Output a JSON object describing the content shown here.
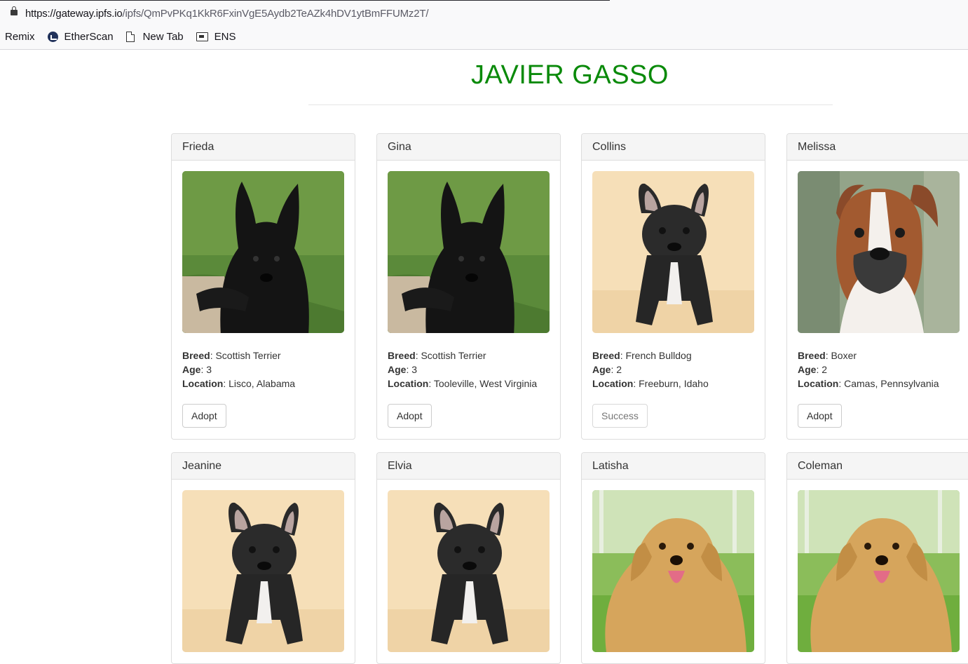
{
  "browser": {
    "url_host": "https://gateway.ipfs.io",
    "url_path": "/ipfs/QmPvPKq1KkR6FxinVgE5Aydb2TeAZk4hDV1ytBmFFUMz2T/",
    "bookmarks": [
      "Remix",
      "EtherScan",
      "New Tab",
      "ENS"
    ]
  },
  "page": {
    "title": "JAVIER GASSO",
    "labels": {
      "breed": "Breed",
      "age": "Age",
      "location": "Location"
    }
  },
  "pets": [
    {
      "name": "Frieda",
      "breed": "Scottish Terrier",
      "age": "3",
      "location": "Lisco, Alabama",
      "button": "Adopt",
      "photo": "scottish-terrier"
    },
    {
      "name": "Gina",
      "breed": "Scottish Terrier",
      "age": "3",
      "location": "Tooleville, West Virginia",
      "button": "Adopt",
      "photo": "scottish-terrier"
    },
    {
      "name": "Collins",
      "breed": "French Bulldog",
      "age": "2",
      "location": "Freeburn, Idaho",
      "button": "Success",
      "photo": "french-bulldog"
    },
    {
      "name": "Melissa",
      "breed": "Boxer",
      "age": "2",
      "location": "Camas, Pennsylvania",
      "button": "Adopt",
      "photo": "boxer"
    },
    {
      "name": "Jeanine",
      "photo": "french-bulldog"
    },
    {
      "name": "Elvia",
      "photo": "french-bulldog"
    },
    {
      "name": "Latisha",
      "photo": "golden-retriever"
    },
    {
      "name": "Coleman",
      "photo": "golden-retriever"
    }
  ]
}
